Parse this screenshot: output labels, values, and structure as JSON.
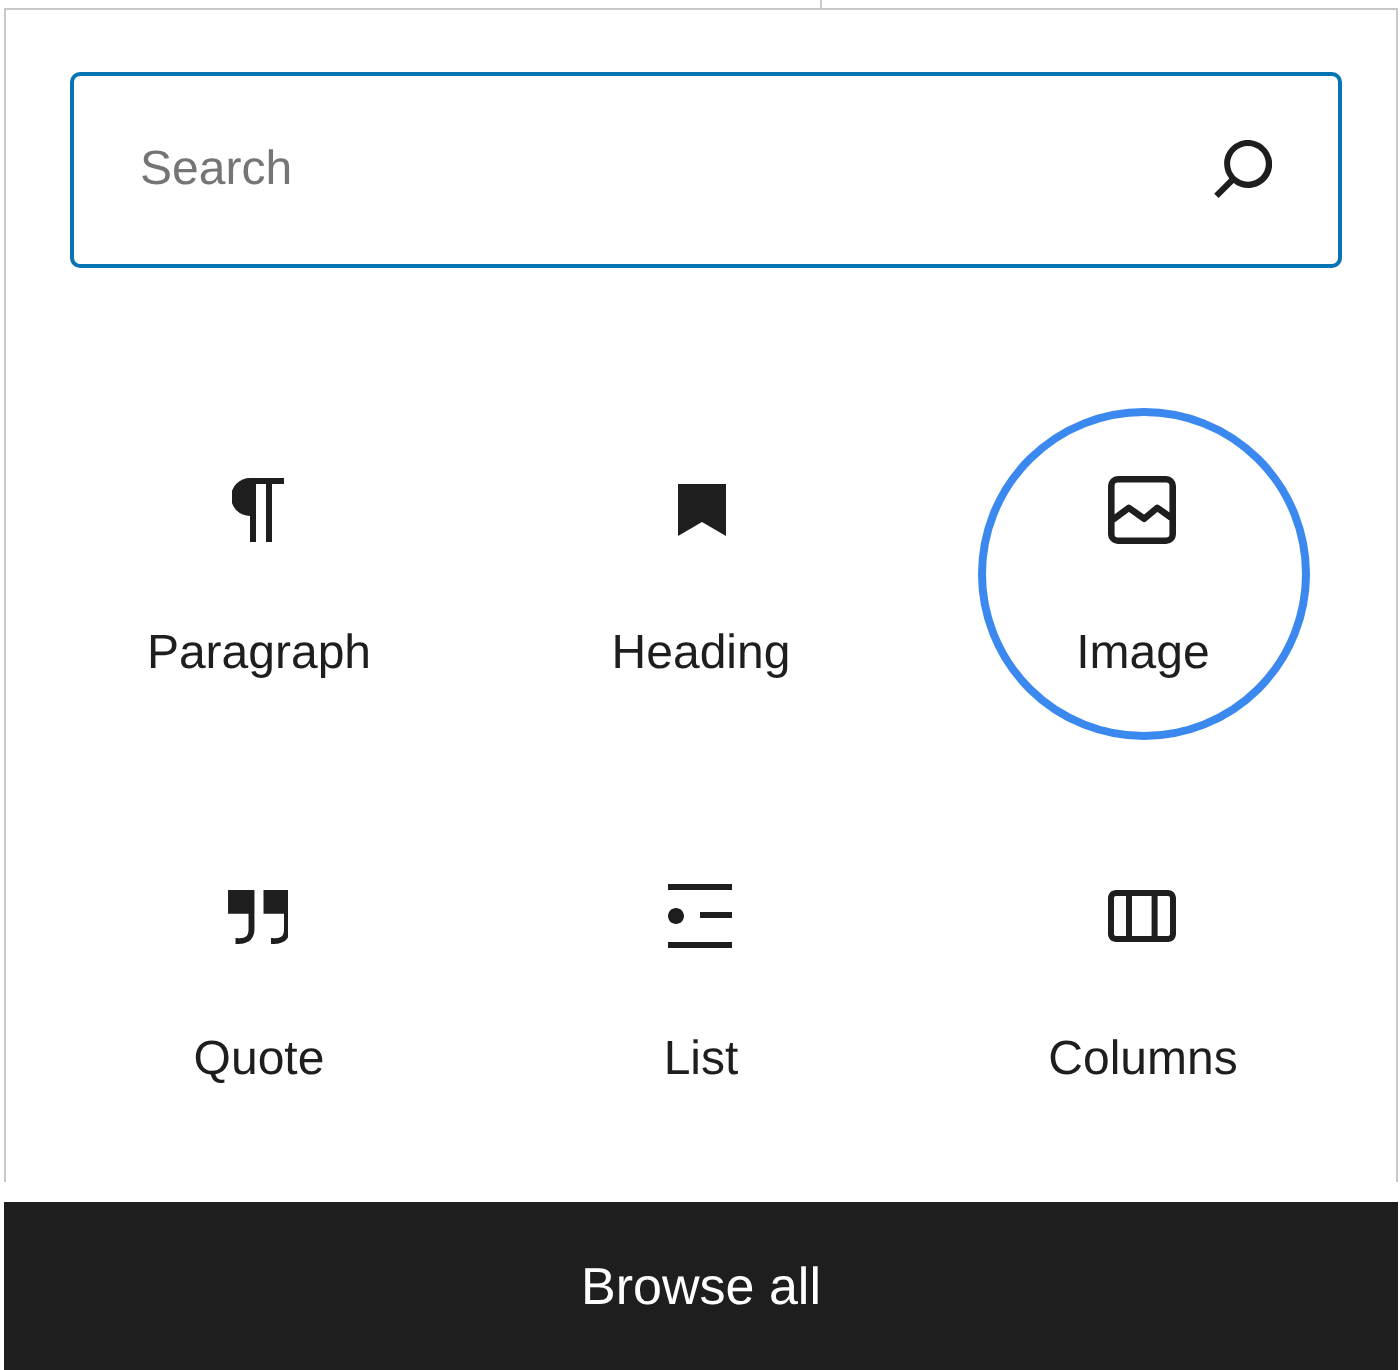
{
  "search": {
    "placeholder": "Search"
  },
  "blocks": [
    {
      "kind": "paragraph",
      "label": "Paragraph",
      "highlighted": false
    },
    {
      "kind": "heading",
      "label": "Heading",
      "highlighted": false
    },
    {
      "kind": "image",
      "label": "Image",
      "highlighted": true
    },
    {
      "kind": "quote",
      "label": "Quote",
      "highlighted": false
    },
    {
      "kind": "list",
      "label": "List",
      "highlighted": false
    },
    {
      "kind": "columns",
      "label": "Columns",
      "highlighted": false
    }
  ],
  "browse_button": {
    "label": "Browse all"
  }
}
